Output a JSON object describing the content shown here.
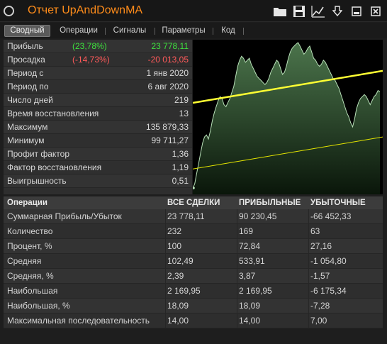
{
  "window": {
    "title": "Отчет UpAndDownMA"
  },
  "toolbar": {
    "icons": [
      "folder-icon",
      "save-icon",
      "chart-export-icon",
      "download-icon",
      "minimize-icon",
      "close-icon"
    ]
  },
  "tabs": [
    {
      "label": "Сводный",
      "active": true
    },
    {
      "label": "Операции",
      "active": false
    },
    {
      "label": "Сигналы",
      "active": false
    },
    {
      "label": "Параметры",
      "active": false
    },
    {
      "label": "Код",
      "active": false
    }
  ],
  "summary": [
    {
      "label": "Прибыль",
      "pct": "(23,78%)",
      "value": "23 778,11",
      "tone": "green"
    },
    {
      "label": "Просадка",
      "pct": "(-14,73%)",
      "value": "-20 013,05",
      "tone": "red"
    },
    {
      "label": "Период с",
      "pct": "",
      "value": "1 янв 2020",
      "tone": ""
    },
    {
      "label": "Период по",
      "pct": "",
      "value": "6 авг 2020",
      "tone": ""
    },
    {
      "label": "Число дней",
      "pct": "",
      "value": "219",
      "tone": ""
    },
    {
      "label": "Время восстановления",
      "pct": "",
      "value": "13",
      "tone": ""
    },
    {
      "label": "Максимум",
      "pct": "",
      "value": "135 879,33",
      "tone": ""
    },
    {
      "label": "Минимум",
      "pct": "",
      "value": "99 711,27",
      "tone": ""
    },
    {
      "label": "Профит фактор",
      "pct": "",
      "value": "1,36",
      "tone": ""
    },
    {
      "label": "Фактор восстановления",
      "pct": "",
      "value": "1,19",
      "tone": ""
    },
    {
      "label": "Выигрышность",
      "pct": "",
      "value": "0,51",
      "tone": ""
    }
  ],
  "chart_data": {
    "type": "area",
    "title": "",
    "xlabel": "",
    "ylabel": "",
    "grid": false,
    "colors": {
      "fill": "#4f7a4f",
      "line": "#b8e0b8",
      "trend": "#ffff33",
      "channel": "#e6e600"
    },
    "y": [
      99711,
      101000,
      103500,
      106000,
      108500,
      111000,
      112500,
      113000,
      112000,
      114000,
      116500,
      118500,
      120000,
      121500,
      122500,
      122000,
      120500,
      120000,
      121000,
      122000,
      123500,
      125000,
      127500,
      130000,
      131500,
      132500,
      132000,
      131000,
      131500,
      132000,
      130500,
      129500,
      128500,
      127500,
      127000,
      126500,
      126000,
      125500,
      126000,
      127000,
      128500,
      129500,
      130500,
      131500,
      131000,
      129500,
      128000,
      128500,
      130000,
      132000,
      133500,
      134500,
      135000,
      135500,
      135879,
      135000,
      134000,
      133000,
      133500,
      134500,
      135000,
      133500,
      132000,
      131500,
      130500,
      130000,
      130500,
      131500,
      131000,
      130000,
      129000,
      128000,
      127000,
      126500,
      125500,
      124500,
      123000,
      121500,
      120000,
      118500,
      117500,
      116000,
      115000,
      117000,
      119500,
      121000,
      122000,
      122500,
      123000,
      122500,
      121500,
      120500,
      121500,
      122500,
      123000,
      124000,
      123778
    ]
  },
  "operations": {
    "headers": [
      "Операции",
      "ВСЕ СДЕЛКИ",
      "ПРИБЫЛЬНЫЕ",
      "УБЫТОЧНЫЕ"
    ],
    "rows": [
      [
        "Суммарная Прибыль/Убыток",
        "23 778,11",
        "90 230,45",
        "-66 452,33"
      ],
      [
        "Количество",
        "232",
        "169",
        "63"
      ],
      [
        "Процент, %",
        "100",
        "72,84",
        "27,16"
      ],
      [
        "Средняя",
        "102,49",
        "533,91",
        "-1 054,80"
      ],
      [
        "Средняя, %",
        "2,39",
        "3,87",
        "-1,57"
      ],
      [
        "Наибольшая",
        "2 169,95",
        "2 169,95",
        "-6 175,34"
      ],
      [
        "Наибольшая, %",
        "18,09",
        "18,09",
        "-7,28"
      ],
      [
        "Максимальная последовательность",
        "14,00",
        "14,00",
        "7,00"
      ]
    ]
  }
}
